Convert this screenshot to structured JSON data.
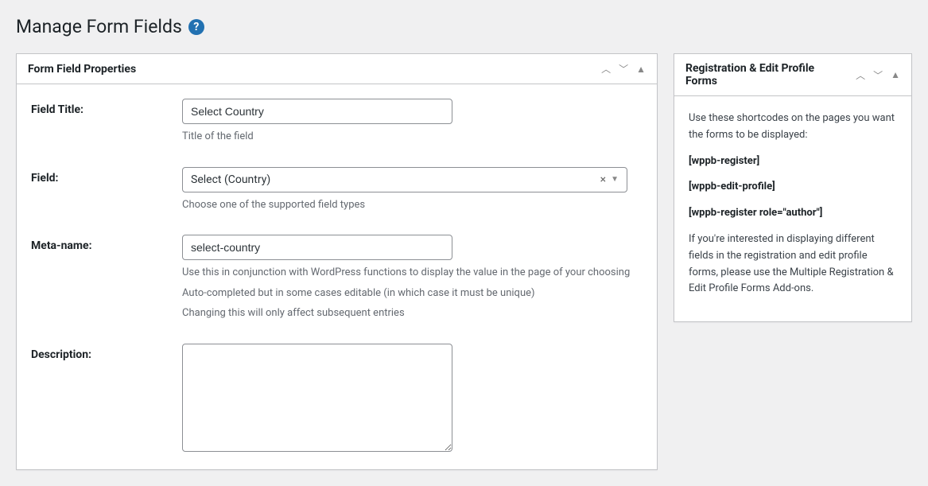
{
  "page": {
    "title": "Manage Form Fields"
  },
  "main_panel": {
    "title": "Form Field Properties"
  },
  "fields": {
    "field_title": {
      "label": "Field Title:",
      "value": "Select Country",
      "help": "Title of the field"
    },
    "field": {
      "label": "Field:",
      "value": "Select (Country)",
      "help": "Choose one of the supported field types"
    },
    "meta_name": {
      "label": "Meta-name:",
      "value": "select-country",
      "help1": "Use this in conjunction with WordPress functions to display the value in the page of your choosing",
      "help2": "Auto-completed but in some cases editable (in which case it must be unique)",
      "help3": "Changing this will only affect subsequent entries"
    },
    "description": {
      "label": "Description:",
      "value": ""
    }
  },
  "sidebar": {
    "title": "Registration & Edit Profile Forms",
    "intro": "Use these shortcodes on the pages you want the forms to be displayed:",
    "code1": "[wppb-register]",
    "code2": "[wppb-edit-profile]",
    "code3": "[wppb-register role=\"author\"]",
    "footer": "If you're interested in displaying different fields in the registration and edit profile forms, please use the Multiple Registration & Edit Profile Forms Add-ons."
  }
}
